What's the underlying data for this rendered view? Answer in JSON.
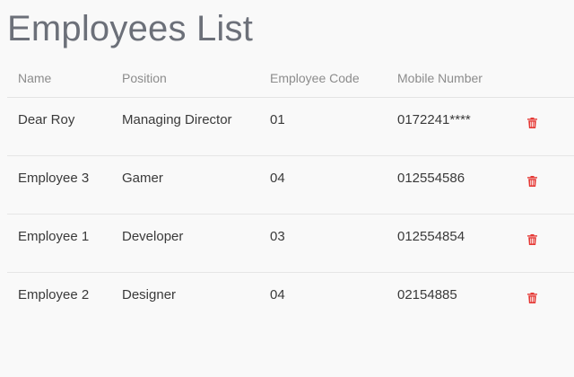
{
  "page": {
    "title": "Employees List"
  },
  "table": {
    "headers": {
      "name": "Name",
      "position": "Position",
      "code": "Employee Code",
      "mobile": "Mobile Number"
    },
    "rows": [
      {
        "name": "Dear Roy",
        "position": "Managing Director",
        "code": "01",
        "mobile": "0172241****"
      },
      {
        "name": "Employee 3",
        "position": "Gamer",
        "code": "04",
        "mobile": "012554586"
      },
      {
        "name": "Employee 1",
        "position": "Developer",
        "code": "03",
        "mobile": "012554854"
      },
      {
        "name": "Employee 2",
        "position": "Designer",
        "code": "04",
        "mobile": "02154885"
      }
    ]
  },
  "icons": {
    "delete": "trash-icon"
  },
  "colors": {
    "title": "#6c7079",
    "header_text": "#8c8c8c",
    "body_text": "#3a3a3a",
    "delete_icon": "#e53935",
    "background": "#f9f9f9"
  }
}
